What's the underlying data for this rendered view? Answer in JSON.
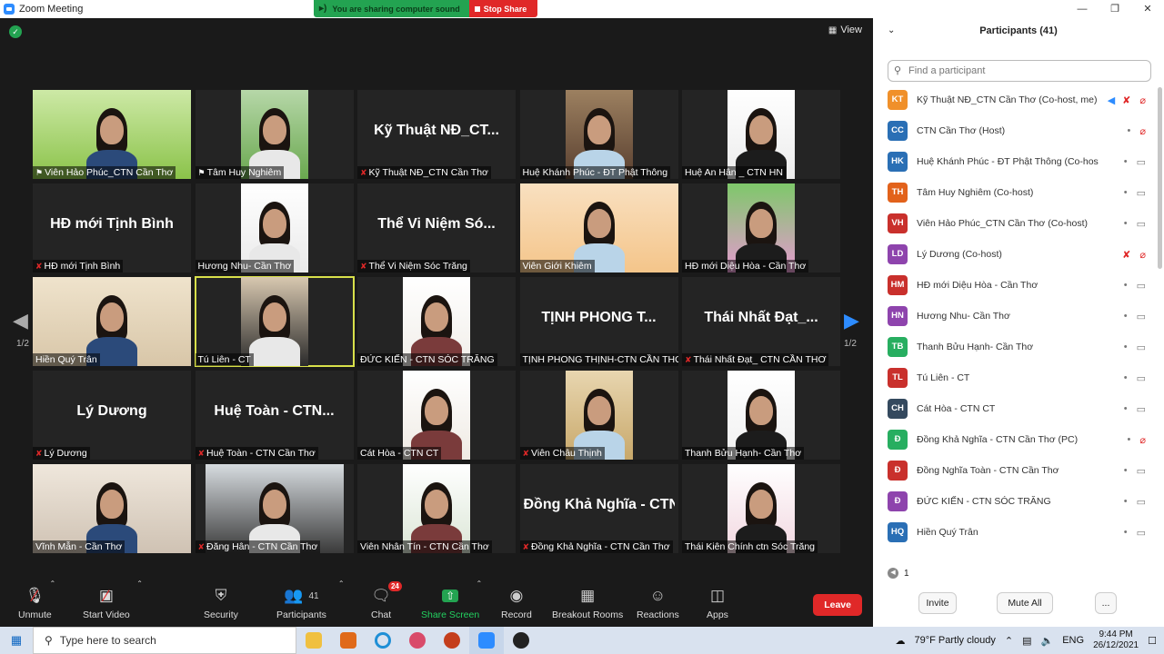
{
  "window": {
    "title": "Zoom Meeting"
  },
  "share_banner": {
    "sound_label": "You are sharing computer sound",
    "stop_label": "Stop Share"
  },
  "view_label": "View",
  "page_indicator": "1/2",
  "tiles": [
    {
      "name": "Viên Hảo Phúc_CTN Cần Thơ",
      "video": true,
      "muted": false,
      "pinned": true
    },
    {
      "name": "Tâm Huy Nghiêm",
      "video": true,
      "muted": false,
      "pinned": true
    },
    {
      "name": "Kỹ Thuật NĐ_CTN Cần Thơ",
      "display": "Kỹ Thuật NĐ_CT...",
      "video": false,
      "muted": true
    },
    {
      "name": "Huệ Khánh Phúc - ĐT Phật Thông",
      "video": true,
      "muted": false
    },
    {
      "name": "Huệ An Hân _ CTN HN",
      "video": true,
      "muted": false
    },
    {
      "name": "HĐ mới Tịnh Bình",
      "display": "HĐ mới Tịnh Bình",
      "video": false,
      "muted": true
    },
    {
      "name": "Hương Nhu- Cần Thơ",
      "video": true,
      "muted": false
    },
    {
      "name": "Thể Vi Niệm Sóc Trăng",
      "display": "Thể Vi Niệm Só...",
      "video": false,
      "muted": true
    },
    {
      "name": "Viên Giới Khiêm",
      "video": true,
      "muted": false
    },
    {
      "name": "HĐ mới Diệu Hòa - Cần Thơ",
      "video": true,
      "muted": false
    },
    {
      "name": "Hiền Quý Trân",
      "video": true,
      "muted": false
    },
    {
      "name": "Tú Liên - CT",
      "video": true,
      "muted": false,
      "active": true
    },
    {
      "name": "ĐỨC KIẾN - CTN SÓC TRĂNG",
      "video": true,
      "muted": false
    },
    {
      "name": "TỊNH PHONG THỊNH-CTN CẦN THƠ",
      "display": "TỊNH PHONG T...",
      "video": false,
      "muted": false
    },
    {
      "name": "Thái Nhất Đạt_ CTN CẦN THƠ",
      "display": "Thái Nhất Đạt_...",
      "video": false,
      "muted": true
    },
    {
      "name": "Lý Dương",
      "display": "Lý Dương",
      "video": false,
      "muted": true
    },
    {
      "name": "Huệ Toàn - CTN Cần Thơ",
      "display": "Huệ Toàn - CTN...",
      "video": false,
      "muted": true
    },
    {
      "name": "Cát Hòa - CTN CT",
      "video": true,
      "muted": false
    },
    {
      "name": "Viên Châu Thịnh",
      "video": true,
      "muted": true
    },
    {
      "name": "Thanh Bửu Hạnh- Cần Thơ",
      "video": true,
      "muted": false
    },
    {
      "name": "Vĩnh Mẫn - Cần Thơ",
      "video": true,
      "muted": false
    },
    {
      "name": "Đăng Hân - CTN Cần Thơ",
      "video": true,
      "muted": true
    },
    {
      "name": "Viên Nhân Tín - CTN Cần Thơ",
      "video": true,
      "muted": false
    },
    {
      "name": "Đồng Khả Nghĩa - CTN Cần Thơ",
      "video": false,
      "muted": true
    },
    {
      "name": "Thái Kiên Chính ctn Sóc Trăng",
      "video": true,
      "muted": false
    }
  ],
  "toolbar": {
    "unmute": "Unmute",
    "start_video": "Start Video",
    "security": "Security",
    "participants": "Participants",
    "participants_count": "41",
    "chat": "Chat",
    "chat_badge": "24",
    "share_screen": "Share Screen",
    "record": "Record",
    "breakout": "Breakout Rooms",
    "reactions": "Reactions",
    "apps": "Apps",
    "leave": "Leave"
  },
  "panel": {
    "title": "Participants (41)",
    "search_placeholder": "Find a participant",
    "participants": [
      {
        "initials": "KT",
        "color": "#f0902a",
        "name": "Kỹ Thuật NĐ_CTN Cần Thơ (Co-host, me)",
        "mic": "off",
        "cam": "off",
        "sharing_audio": true
      },
      {
        "initials": "CC",
        "color": "#2a6fb5",
        "name": "CTN Cần Thơ (Host)",
        "mic": "on",
        "cam": "off"
      },
      {
        "initials": "HK",
        "color": "#2a6fb5",
        "name": "Huệ Khánh Phúc - ĐT Phật Thông (Co-host)",
        "mic": "on",
        "cam": "on"
      },
      {
        "initials": "TH",
        "color": "#e2621b",
        "name": "Tâm Huy Nghiêm (Co-host)",
        "mic": "on",
        "cam": "on"
      },
      {
        "initials": "VH",
        "color": "#c9302c",
        "name": "Viên Hảo Phúc_CTN Cần Thơ (Co-host)",
        "mic": "on",
        "cam": "on"
      },
      {
        "initials": "LD",
        "color": "#8e44ad",
        "name": "Lý Dương (Co-host)",
        "mic": "off",
        "cam": "off"
      },
      {
        "initials": "HM",
        "color": "#c9302c",
        "name": "HĐ mới Diệu Hòa - Cần Thơ",
        "mic": "on",
        "cam": "on"
      },
      {
        "initials": "HN",
        "color": "#8e44ad",
        "name": "Hương Nhu- Cần Thơ",
        "mic": "on",
        "cam": "on"
      },
      {
        "initials": "TB",
        "color": "#27ae60",
        "name": "Thanh Bửu Hạnh- Cần Thơ",
        "mic": "on",
        "cam": "on"
      },
      {
        "initials": "TL",
        "color": "#c9302c",
        "name": "Tú Liên - CT",
        "mic": "on",
        "cam": "on"
      },
      {
        "initials": "CH",
        "color": "#34495e",
        "name": "Cát Hòa - CTN CT",
        "mic": "on",
        "cam": "on"
      },
      {
        "initials": "Đ",
        "color": "#27ae60",
        "name": "Đồng Khả Nghĩa - CTN Cần Thơ (PC)",
        "mic": "on",
        "cam": "off"
      },
      {
        "initials": "Đ",
        "color": "#c9302c",
        "name": "Đồng Nghĩa Toàn - CTN Cần Thơ",
        "mic": "on",
        "cam": "on"
      },
      {
        "initials": "Đ",
        "color": "#8e44ad",
        "name": "ĐỨC KIẾN - CTN SÓC TRĂNG",
        "mic": "on",
        "cam": "on"
      },
      {
        "initials": "HQ",
        "color": "#2a6fb5",
        "name": "Hiền Quý Trân",
        "mic": "on",
        "cam": "on"
      }
    ],
    "page": "1",
    "invite": "Invite",
    "mute_all": "Mute All",
    "more": "..."
  },
  "taskbar": {
    "search_placeholder": "Type here to search",
    "weather": "79°F  Partly cloudy",
    "lang": "ENG",
    "time": "9:44 PM",
    "date": "26/12/2021"
  }
}
